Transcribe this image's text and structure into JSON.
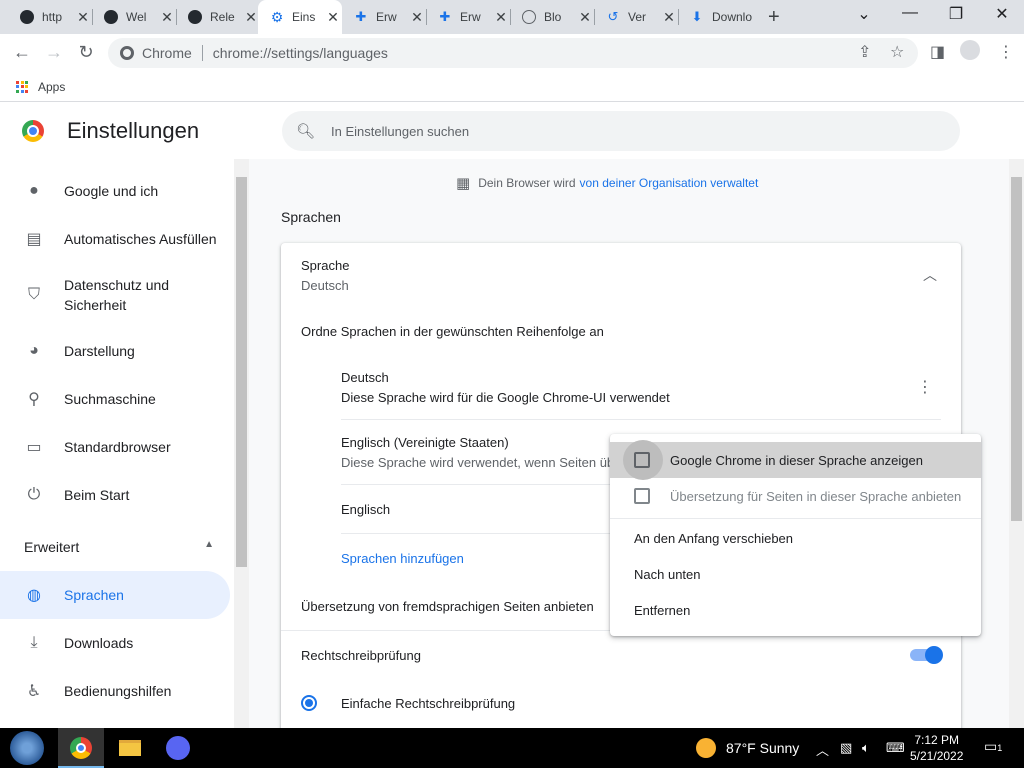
{
  "browser": {
    "tabs": [
      {
        "title": "http",
        "favicon": "github-dark-icon"
      },
      {
        "title": "Wel",
        "favicon": "github-dark-icon"
      },
      {
        "title": "Rele",
        "favicon": "github-icon"
      },
      {
        "title": "Eins",
        "favicon": "gear-icon",
        "active": true
      },
      {
        "title": "Erw",
        "favicon": "puzzle-icon"
      },
      {
        "title": "Erw",
        "favicon": "puzzle-icon"
      },
      {
        "title": "Blo",
        "favicon": "globe-icon"
      },
      {
        "title": "Ver",
        "favicon": "history-icon"
      },
      {
        "title": "Downlo",
        "favicon": "download-icon"
      }
    ],
    "omnibox": {
      "chip": "Chrome",
      "url": "chrome://settings/languages"
    },
    "bookmarks": {
      "apps": "Apps"
    }
  },
  "settings": {
    "title": "Einstellungen",
    "search_placeholder": "In Einstellungen suchen",
    "managed_text": "Dein Browser wird",
    "managed_link": "von deiner Organisation verwaltet",
    "sidebar": {
      "items": [
        {
          "label": "Google und ich",
          "icon": "person-icon"
        },
        {
          "label": "Automatisches Ausfüllen",
          "icon": "clipboard-icon"
        },
        {
          "label": "Datenschutz und Sicherheit",
          "icon": "shield-icon"
        },
        {
          "label": "Darstellung",
          "icon": "palette-icon"
        },
        {
          "label": "Suchmaschine",
          "icon": "search-icon"
        },
        {
          "label": "Standardbrowser",
          "icon": "browser-window-icon"
        },
        {
          "label": "Beim Start",
          "icon": "power-icon"
        }
      ],
      "advanced": "Erweitert",
      "advanced_items": [
        {
          "label": "Sprachen",
          "icon": "globe-icon",
          "active": true
        },
        {
          "label": "Downloads",
          "icon": "download-icon"
        },
        {
          "label": "Bedienungshilfen",
          "icon": "accessibility-icon"
        }
      ]
    },
    "languages": {
      "section_title": "Sprachen",
      "language_label": "Sprache",
      "language_value": "Deutsch",
      "order_text": "Ordne Sprachen in der gewünschten Reihenfolge an",
      "entries": [
        {
          "name": "Deutsch",
          "desc": "Diese Sprache wird für die Google Chrome-UI verwendet"
        },
        {
          "name": "Englisch (Vereinigte Staaten)",
          "desc": "Diese Sprache wird verwendet, wenn Seiten übe"
        },
        {
          "name": "Englisch",
          "desc": ""
        }
      ],
      "add_languages": "Sprachen hinzufügen",
      "offer_translate": "Übersetzung von fremdsprachigen Seiten anbieten",
      "spellcheck": "Rechtschreibprüfung",
      "spellcheck_enabled": true,
      "basic_spellcheck": "Einfache Rechtschreibprüfung"
    },
    "context_menu": {
      "items": [
        {
          "label": "Google Chrome in dieser Sprache anzeigen",
          "checkbox": true,
          "checked": false,
          "highlighted": true
        },
        {
          "label": "Übersetzung für Seiten in dieser Sprache anbieten",
          "checkbox": true,
          "checked": false,
          "disabled": true
        },
        {
          "label": "An den Anfang verschieben"
        },
        {
          "label": "Nach unten"
        },
        {
          "label": "Entfernen"
        }
      ]
    }
  },
  "taskbar": {
    "weather": "87°F  Sunny",
    "time": "7:12 PM",
    "date": "5/21/2022",
    "notifications": "1"
  },
  "colors": {
    "accent": "#1a73e8",
    "active_bg": "#e8f0fe",
    "menu_highlight": "#d2d2d2"
  }
}
